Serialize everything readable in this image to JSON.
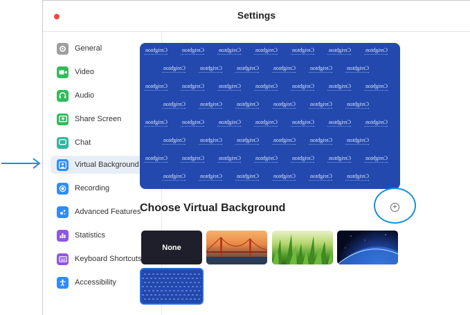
{
  "window": {
    "title": "Settings"
  },
  "sidebar": {
    "items": [
      {
        "label": "General",
        "icon": "gear-icon",
        "color": "#9e9e9e"
      },
      {
        "label": "Video",
        "icon": "video-camera-icon",
        "color": "#2ebd59"
      },
      {
        "label": "Audio",
        "icon": "headphones-icon",
        "color": "#2ebd59"
      },
      {
        "label": "Share Screen",
        "icon": "share-screen-icon",
        "color": "#2ebd59"
      },
      {
        "label": "Chat",
        "icon": "chat-bubble-icon",
        "color": "#2eb8a0"
      },
      {
        "label": "Virtual Background",
        "icon": "person-frame-icon",
        "color": "#2d8cff",
        "active": true
      },
      {
        "label": "Recording",
        "icon": "record-icon",
        "color": "#2d8cff"
      },
      {
        "label": "Advanced Features",
        "icon": "sparkle-icon",
        "color": "#2d8cff"
      },
      {
        "label": "Statistics",
        "icon": "bar-chart-icon",
        "color": "#8f54e8"
      },
      {
        "label": "Keyboard Shortcuts",
        "icon": "keyboard-icon",
        "color": "#8f54e8"
      },
      {
        "label": "Accessibility",
        "icon": "accessibility-icon",
        "color": "#2d8cff"
      }
    ]
  },
  "main": {
    "section_heading": "Choose Virtual Background",
    "add_button_label": "+",
    "watermark_text": "Creighton",
    "thumbnails": [
      {
        "label": "None",
        "kind": "none"
      },
      {
        "label": "",
        "kind": "golden-gate-bridge"
      },
      {
        "label": "",
        "kind": "grass"
      },
      {
        "label": "",
        "kind": "earth-from-space"
      },
      {
        "label": "",
        "kind": "custom-blue-pattern",
        "selected": true
      }
    ]
  },
  "colors": {
    "accent": "#2d8cff",
    "preview_bg": "#2349ae",
    "annotation": "#1b8fd0"
  }
}
